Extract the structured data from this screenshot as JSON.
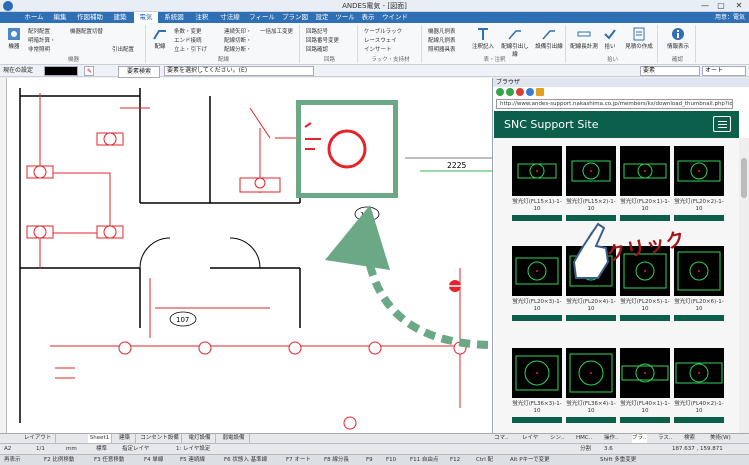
{
  "window": {
    "title": "ANDES電気 - [図面]",
    "minimize": "—",
    "maximize": "▢",
    "close": "✕"
  },
  "menu": {
    "items": [
      "ホーム",
      "編集",
      "作図補助",
      "建築",
      "電気",
      "系統図",
      "注釈",
      "寸法線",
      "フィールド",
      "プラン図",
      "設定",
      "ツール",
      "表示",
      "ウインドウ"
    ],
    "active_index": 4,
    "user": "用意：電気"
  },
  "ribbon": {
    "groups": [
      {
        "label": "機器",
        "buttons": [
          "機器",
          "配列配置",
          "明暗計算・",
          "非常照明",
          "機器配置切替",
          "引出配置"
        ]
      },
      {
        "label": "配線",
        "buttons": [
          "配線",
          "条数・変更",
          "エンド接続",
          "立上・引下げ",
          "連続矢印・",
          "配線切断・",
          "配線分断・",
          "一括加工変更"
        ]
      },
      {
        "label": "回路",
        "buttons": [
          "回路記号",
          "回路番号変更",
          "回路確認"
        ]
      },
      {
        "label": "ラック・支持材",
        "buttons": [
          "ケーブルラック",
          "レースウェイ",
          "インサート"
        ]
      },
      {
        "label": "表・注釈",
        "buttons": [
          "機器凡例表",
          "配線凡例表",
          "照明器具表",
          "注釈記入",
          "配線引出し線",
          "設備引出線"
        ]
      },
      {
        "label": "拾い",
        "buttons": [
          "配線長計測",
          "拾い",
          "見積の作成"
        ]
      },
      {
        "label": "確認",
        "buttons": [
          "情報表示"
        ]
      }
    ]
  },
  "options": {
    "layer_label": "現在の設定",
    "search_label": "要素検索",
    "prompt": "要素を選択してください。(E)",
    "combo_value": "要素",
    "auto_value": "オート"
  },
  "drawing": {
    "room_number": "2225",
    "circle_labels": [
      "106",
      "107"
    ]
  },
  "sheet_tabs": [
    "レイアウト",
    "Sheet1",
    "建築",
    "コンセント設備",
    "電灯設備",
    "弱電設備"
  ],
  "sheet_active_index": 1,
  "browser": {
    "panel_title": "ブラウザ",
    "url": "http://www.andes-support.nakashima.co.jp/members/ks/download_thumbnail.php?id=2258",
    "site_title": "SNC Support Site",
    "items": [
      "蛍光灯(FL15×1)-1-10",
      "蛍光灯(FL15×2)-1-10",
      "蛍光灯(FL20×1)-1-10",
      "蛍光灯(FL20×2)-1-10",
      "蛍光灯(FL20×3)-1-10",
      "蛍光灯(FL20×4)-1-10",
      "蛍光灯(FL20×5)-1-10",
      "蛍光灯(FL20×6)-1-10",
      "蛍光灯(FL36×3)-1-10",
      "蛍光灯(FL36×4)-1-10",
      "蛍光灯(FL40×1)-1-10",
      "蛍光灯(FL40×2)-1-10"
    ]
  },
  "browser_tabs": [
    "コマ..",
    "レイヤ",
    "シン..",
    "HMC..",
    "操作..",
    "ブラ..",
    "ラス..",
    "検索",
    "美術(W)"
  ],
  "annotation": {
    "click_text": "クリック"
  },
  "status": {
    "items": [
      "A2",
      "1/1",
      "mm",
      "標準",
      "指定レイヤ",
      "1: レイヤ設定",
      "分割",
      "3.6"
    ],
    "bottom": [
      "再表示",
      "F2 比例移動",
      "F3 任意移動",
      "F4 単線",
      "F5 連続線",
      "F6 状態入 基準線",
      "F7 オート",
      "F8 線分長",
      "F9",
      "F10",
      "F11 自由点",
      "F12",
      "Ctrl 配",
      "Alt Pキーで変更",
      "Shift 多重変更"
    ],
    "coords": "187.637 , 159.871"
  },
  "colors": {
    "accent": "#2f6fb3",
    "site_green": "#0b5f4b",
    "drawing_red": "#e4232a",
    "callout_green": "#6aa886",
    "click_red": "#a3151b"
  }
}
